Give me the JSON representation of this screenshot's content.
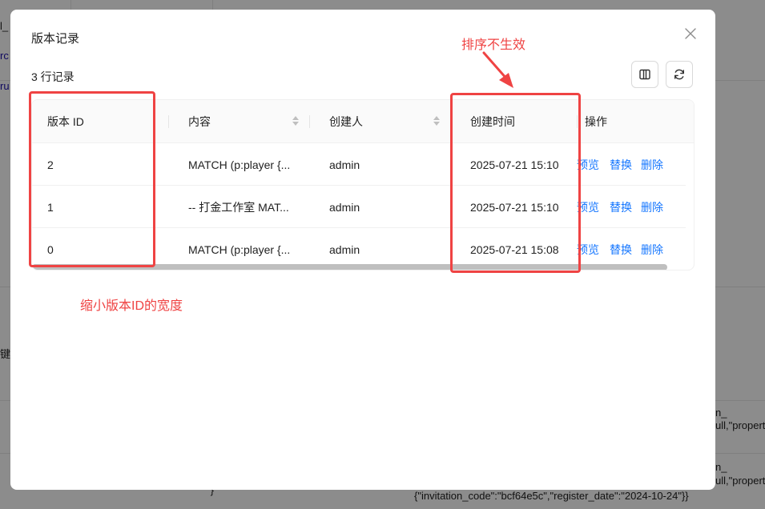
{
  "background": {
    "snippets": [
      "l_",
      "rc",
      "ru",
      "键",
      "n_",
      "ull,\"propert",
      "n_",
      "ull,\"propert",
      "{\"invitation_code\":\"bcf64e5c\",\"register_date\":\"2024-10-24\"}}",
      "\"}"
    ]
  },
  "modal": {
    "title": "版本记录",
    "record_count": "3 行记录",
    "close_icon": "close-icon",
    "toolbar": {
      "column_settings_icon": "columns-icon",
      "refresh_icon": "refresh-icon"
    },
    "table": {
      "columns": [
        {
          "label": "版本 ID",
          "sortable": false
        },
        {
          "label": "内容",
          "sortable": true
        },
        {
          "label": "创建人",
          "sortable": true
        },
        {
          "label": "创建时间",
          "sortable": false
        },
        {
          "label": "操作",
          "sortable": false
        }
      ],
      "rows": [
        {
          "id": "2",
          "content": "MATCH (p:player {...",
          "creator": "admin",
          "created_at": "2025-07-21 15:10",
          "actions": [
            "预览",
            "替换",
            "删除"
          ]
        },
        {
          "id": "1",
          "content": "-- 打金工作室 MAT...",
          "creator": "admin",
          "created_at": "2025-07-21 15:10",
          "actions": [
            "预览",
            "替换",
            "删除"
          ]
        },
        {
          "id": "0",
          "content": "MATCH (p:player {...",
          "creator": "admin",
          "created_at": "2025-07-21 15:08",
          "actions": [
            "预览",
            "替换",
            "删除"
          ]
        }
      ]
    }
  },
  "annotations": {
    "sort_note": "排序不生效",
    "width_note": "缩小版本ID的宽度",
    "color": "#ef4343"
  }
}
